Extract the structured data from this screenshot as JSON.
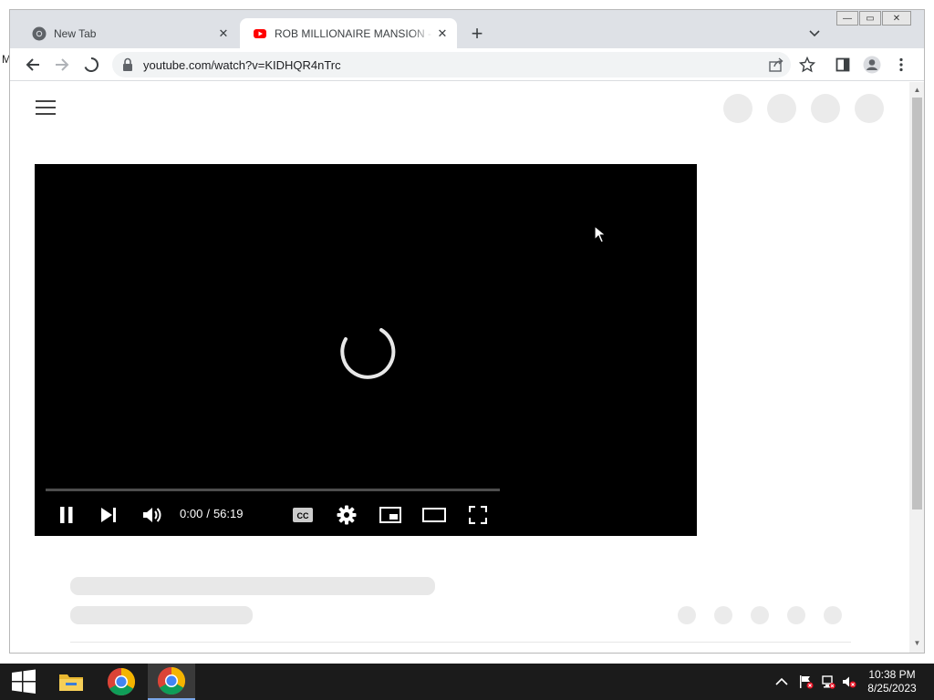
{
  "browser": {
    "tabs": [
      {
        "title": "New Tab",
        "favicon": "chrome-icon",
        "active": false
      },
      {
        "title": "ROB MILLIONAIRE MANSION - RO",
        "favicon": "youtube-icon",
        "active": true
      }
    ],
    "address": {
      "url": "youtube.com/watch?v=KIDHQR4nTrc"
    },
    "window_controls": {
      "minimize": "—",
      "maximize": "▭",
      "close": "✕"
    }
  },
  "desktop": {
    "edge_letter": "M"
  },
  "player": {
    "current_time": "0:00",
    "separator": "/",
    "duration": "56:19",
    "cc_label": "CC",
    "progress_fraction": 0.0
  },
  "colors": {
    "tab_strip": "#dee1e6",
    "youtube_red": "#ff0000",
    "player_bg": "#000000",
    "placeholder": "#e8e8e8",
    "taskbar": "#1b1b1b"
  },
  "taskbar": {
    "clock_time": "10:38 PM",
    "clock_date": "8/25/2023",
    "apps": [
      "windows-start-icon",
      "file-explorer-icon",
      "chrome-icon",
      "chrome-icon"
    ]
  }
}
